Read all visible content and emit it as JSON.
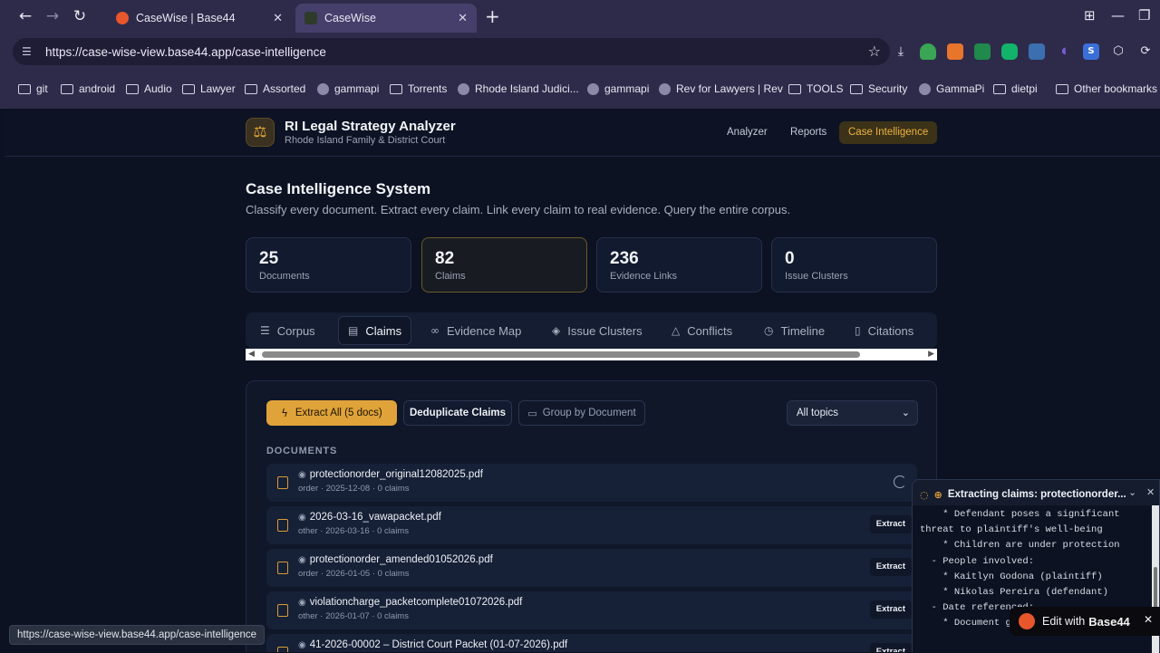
{
  "browser": {
    "tabs": [
      {
        "title": "CaseWise | Base44",
        "active": false
      },
      {
        "title": "CaseWise",
        "active": true
      }
    ],
    "url": "https://case-wise-view.base44.app/case-intelligence",
    "bookmarks": [
      "git",
      "android",
      "Audio",
      "Lawyer",
      "Assorted",
      "gammapi",
      "Torrents",
      "Rhode Island Judici...",
      "gammapi",
      "Rev for Lawyers | Rev",
      "TOOLS",
      "Security",
      "GammaPi",
      "dietpi"
    ],
    "other_bookmarks": "Other bookmarks",
    "status_url": "https://case-wise-view.base44.app/case-intelligence"
  },
  "app": {
    "title": "RI Legal Strategy Analyzer",
    "subtitle": "Rhode Island Family & District Court",
    "nav": [
      "Analyzer",
      "Reports",
      "Case Intelligence"
    ]
  },
  "page": {
    "heading": "Case Intelligence System",
    "lead": "Classify every document. Extract every claim. Link every claim to real evidence. Query the entire corpus.",
    "stats": [
      {
        "value": "25",
        "label": "Documents"
      },
      {
        "value": "82",
        "label": "Claims"
      },
      {
        "value": "236",
        "label": "Evidence Links"
      },
      {
        "value": "0",
        "label": "Issue Clusters"
      }
    ],
    "tabs": [
      "Corpus",
      "Claims",
      "Evidence Map",
      "Issue Clusters",
      "Conflicts",
      "Timeline",
      "Citations"
    ],
    "active_tab": "Claims"
  },
  "toolbar": {
    "extract_label": "Extract All (5 docs)",
    "dedup_label": "Deduplicate Claims",
    "group_label": "Group by Document",
    "topic_select": "All topics"
  },
  "documents": {
    "section_label": "DOCUMENTS",
    "extract_label": "Extract",
    "items": [
      {
        "name": "protectionorder_original12082025.pdf",
        "meta": "order · 2025-12-08 · 0 claims",
        "state": "loading"
      },
      {
        "name": "2026-03-16_vawapacket.pdf",
        "meta": "other · 2026-03-16 · 0 claims",
        "state": "extract"
      },
      {
        "name": "protectionorder_amended01052026.pdf",
        "meta": "order · 2026-01-05 · 0 claims",
        "state": "extract"
      },
      {
        "name": "violationcharge_packetcomplete01072026.pdf",
        "meta": "other · 2026-01-07 · 0 claims",
        "state": "extract"
      },
      {
        "name": "41-2026-00002 – District Court Packet (01-07-2026).pdf",
        "meta": "",
        "state": "extract"
      }
    ]
  },
  "extraction_toast": {
    "title": "Extracting claims: protectionorder...",
    "log": "    * Defendant poses a significant threat to plaintiff's well-being\n    * Children are under protection\n  - People involved:\n    * Kaitlyn Godona (plaintiff)\n    * Nikolas Pereira (defendant)\n  - Date referenced:\n    * Document gr"
  },
  "edit_badge": {
    "prefix": "Edit with",
    "brand": "Base44"
  },
  "colors": {
    "accent": "#e0a33a",
    "background": "#0c1222",
    "browser_chrome": "#2e2b4a"
  }
}
